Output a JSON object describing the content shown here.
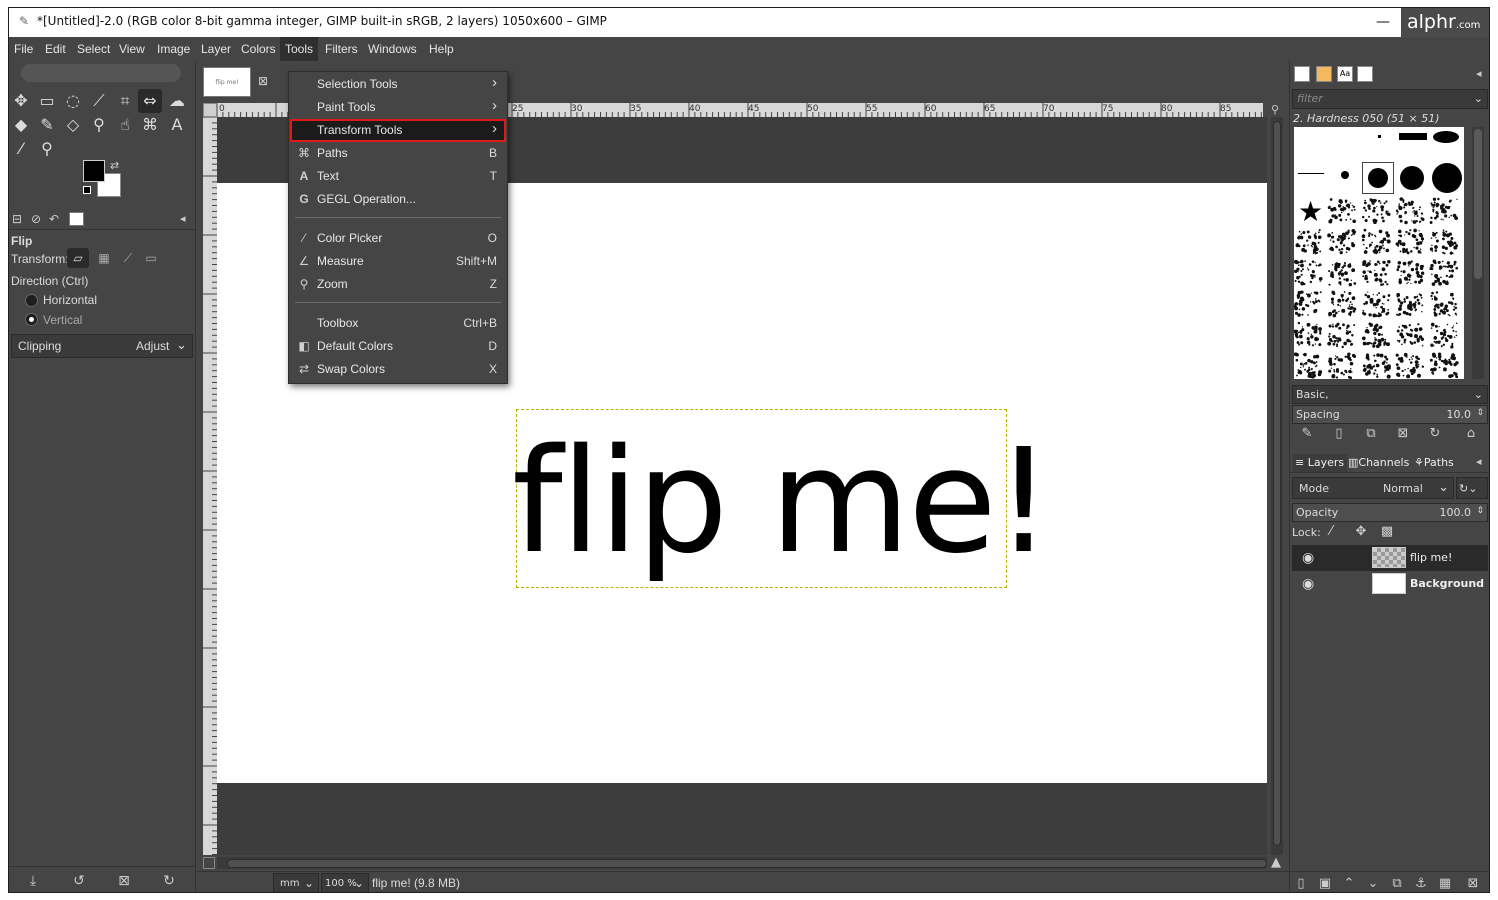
{
  "window": {
    "title": "*[Untitled]-2.0 (RGB color 8-bit gamma integer, GIMP built-in sRGB, 2 layers) 1050x600 – GIMP",
    "minimize": "—",
    "watermark": "alphr",
    "watermark_suffix": ".com"
  },
  "menubar": [
    "File",
    "Edit",
    "Select",
    "View",
    "Image",
    "Layer",
    "Colors",
    "Tools",
    "Filters",
    "Windows",
    "Help"
  ],
  "tools_menu": {
    "items": [
      {
        "label": "Selection Tools",
        "shortcut": "",
        "submenu": true,
        "icon": ""
      },
      {
        "label": "Paint Tools",
        "shortcut": "",
        "submenu": true,
        "icon": ""
      },
      {
        "label": "Transform Tools",
        "shortcut": "",
        "submenu": true,
        "icon": "",
        "highlighted": true
      },
      {
        "label": "Paths",
        "shortcut": "B",
        "icon": "paths-icon"
      },
      {
        "label": "Text",
        "shortcut": "T",
        "icon": "text-icon"
      },
      {
        "label": "GEGL Operation...",
        "shortcut": "",
        "icon": "gegl-icon"
      },
      {
        "label": "Color Picker",
        "shortcut": "O",
        "icon": "color-picker-icon"
      },
      {
        "label": "Measure",
        "shortcut": "Shift+M",
        "icon": "measure-icon"
      },
      {
        "label": "Zoom",
        "shortcut": "Z",
        "icon": "zoom-icon"
      },
      {
        "label": "Toolbox",
        "shortcut": "Ctrl+B",
        "icon": ""
      },
      {
        "label": "Default Colors",
        "shortcut": "D",
        "icon": "default-colors-icon"
      },
      {
        "label": "Swap Colors",
        "shortcut": "X",
        "icon": "swap-colors-icon"
      }
    ]
  },
  "tool_options": {
    "title": "Flip",
    "transform_label": "Transform:",
    "direction_label": "Direction  (Ctrl)",
    "horizontal": "Horizontal",
    "vertical": "Vertical",
    "clipping_label": "Clipping",
    "clipping_value": "Adjust"
  },
  "canvas": {
    "thumb_text": "flip me!",
    "text_layer": "flip me!",
    "ruler_marks": [
      "0",
      "25",
      "30",
      "35",
      "40",
      "45",
      "50",
      "55",
      "60",
      "65",
      "70",
      "75",
      "80",
      "85"
    ]
  },
  "statusbar": {
    "unit": "mm",
    "zoom": "100 %",
    "info": "flip me! (9.8 MB)"
  },
  "brushes": {
    "filter_placeholder": "filter",
    "name": "2. Hardness 050 (51 × 51)",
    "preset": "Basic,",
    "spacing_label": "Spacing",
    "spacing_value": "10.0"
  },
  "layers_panel": {
    "tabs": [
      "Layers",
      "Channels",
      "Paths"
    ],
    "mode_label": "Mode",
    "mode_value": "Normal",
    "opacity_label": "Opacity",
    "opacity_value": "100.0",
    "lock_label": "Lock:",
    "layers": [
      {
        "name": "flip me!"
      },
      {
        "name": "Background"
      }
    ]
  },
  "colors": {
    "foreground": "#000000",
    "background": "#ffffff",
    "highlight_border": "#e01818"
  }
}
